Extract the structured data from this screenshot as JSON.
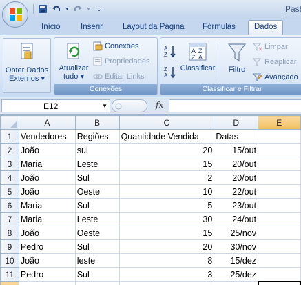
{
  "window": {
    "title_partial": "Past"
  },
  "quick_access": [
    "save-icon",
    "undo-icon",
    "redo-icon",
    "customize-icon"
  ],
  "tabs": [
    {
      "label": "Início",
      "active": false
    },
    {
      "label": "Inserir",
      "active": false
    },
    {
      "label": "Layout da Página",
      "active": false
    },
    {
      "label": "Fórmulas",
      "active": false
    },
    {
      "label": "Dados",
      "active": true
    }
  ],
  "ribbon": {
    "obter_dados": {
      "line1": "Obter Dados",
      "line2": "Externos"
    },
    "conexoes_group": {
      "label": "Conexões",
      "atualizar": {
        "line1": "Atualizar",
        "line2": "tudo"
      },
      "conexoes": "Conexões",
      "propriedades": "Propriedades",
      "editar_links": "Editar Links"
    },
    "classificar_group": {
      "label": "Classificar e Filtrar",
      "classificar": "Classificar",
      "filtro": "Filtro",
      "limpar": "Limpar",
      "reaplicar": "Reaplicar",
      "avancado": "Avançado"
    }
  },
  "formula_bar": {
    "name_box": "E12",
    "fx": "fx",
    "formula": ""
  },
  "sheet": {
    "columns": [
      "A",
      "B",
      "C",
      "D",
      "E"
    ],
    "selected_column": "E",
    "selected_row": "12",
    "rows": [
      {
        "n": "1",
        "cells": [
          "Vendedores",
          "Regiões",
          "Quantidade Vendida",
          "Datas",
          ""
        ]
      },
      {
        "n": "2",
        "cells": [
          "João",
          "sul",
          "20",
          "15/out",
          ""
        ]
      },
      {
        "n": "3",
        "cells": [
          "Maria",
          "Leste",
          "15",
          "20/out",
          ""
        ]
      },
      {
        "n": "4",
        "cells": [
          "João",
          "Sul",
          "2",
          "20/out",
          ""
        ]
      },
      {
        "n": "5",
        "cells": [
          "João",
          "Oeste",
          "10",
          "22/out",
          ""
        ]
      },
      {
        "n": "6",
        "cells": [
          "Maria",
          "Sul",
          "5",
          "23/out",
          ""
        ]
      },
      {
        "n": "7",
        "cells": [
          "Maria",
          "Leste",
          "30",
          "24/out",
          ""
        ]
      },
      {
        "n": "8",
        "cells": [
          "João",
          "Oeste",
          "15",
          "25/nov",
          ""
        ]
      },
      {
        "n": "9",
        "cells": [
          "Pedro",
          "Sul",
          "20",
          "30/nov",
          ""
        ]
      },
      {
        "n": "10",
        "cells": [
          "João",
          "leste",
          "8",
          "15/dez",
          ""
        ]
      },
      {
        "n": "11",
        "cells": [
          "Pedro",
          "Sul",
          "3",
          "25/dez",
          ""
        ]
      },
      {
        "n": "12",
        "cells": [
          "",
          "",
          "",
          "",
          ""
        ]
      }
    ]
  }
}
